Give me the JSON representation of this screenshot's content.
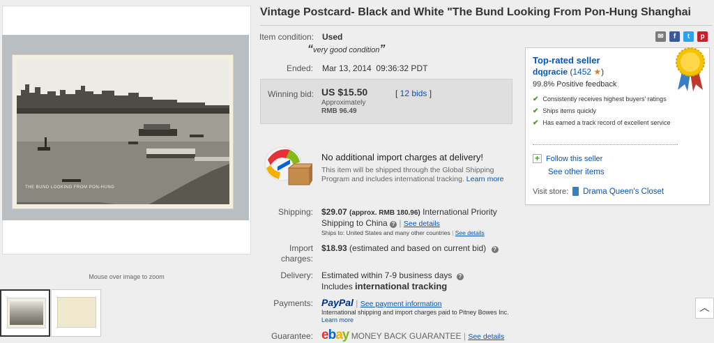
{
  "listing": {
    "title": "Vintage Postcard- Black and White \"The Bund Looking From Pon-Hung Shanghai",
    "condition_label": "Item condition:",
    "condition_value": "Used",
    "condition_note": "very good condition",
    "ended_label": "Ended:",
    "ended_value": "Mar 13, 2014",
    "ended_time": "09:36:32 PDT",
    "bid_label": "Winning bid:",
    "bid_value": "US $15.50",
    "bids_link": "12 bids",
    "approx_label": "Approximately",
    "approx_value": "RMB 96.49"
  },
  "image": {
    "zoom_hint": "Mouse over image to zoom",
    "postcard_caption": "THE BUND LOOKING FROM PON-HUNG"
  },
  "import_promo": {
    "heading": "No additional import charges at delivery!",
    "body": "This item will be shipped through the Global Shipping Program and includes international tracking.",
    "learn_more": "Learn more"
  },
  "shipping": {
    "label": "Shipping:",
    "price": "$29.07",
    "approx": "(approx. RMB 180.96)",
    "service": "International Priority Shipping to China",
    "see_details": "See details",
    "ships_to": "Ships to:  United States and many other countries",
    "ships_to_details": "See details"
  },
  "import_charges": {
    "label_line1": "Import",
    "label_line2": "charges:",
    "amount": "$18.93",
    "note": "(estimated and based on current bid)"
  },
  "delivery": {
    "label": "Delivery:",
    "estimate": "Estimated within 7-9 business days",
    "includes": "Includes",
    "tracking": "international tracking"
  },
  "payments": {
    "label": "Payments:",
    "paypal": "PayPal",
    "see_payment": "See payment information",
    "note": "International shipping and import charges paid to Pitney Bowes Inc.",
    "learn_more": "Learn more"
  },
  "guarantee": {
    "label": "Guarantee:",
    "brand": "ebay",
    "text": "MONEY BACK GUARANTEE",
    "see_details": "See details"
  },
  "seller": {
    "badge_title": "Top-rated seller",
    "username": "dqgracie",
    "score": "1452",
    "feedback": "99.8% Positive feedback",
    "features": [
      "Consistently receives highest buyers' ratings",
      "Ships items quickly",
      "Has earned a track record of excellent service"
    ],
    "follow": "Follow this seller",
    "see_other": "See other items",
    "visit_store_label": "Visit store:",
    "store_name": "Drama Queen's Closet"
  },
  "share_icons": [
    "email-icon",
    "facebook-icon",
    "twitter-icon",
    "pinterest-icon"
  ],
  "colors": {
    "link": "#0654ba",
    "ebay_e": "#e53238",
    "ebay_b": "#0064d2",
    "ebay_a": "#f5af02",
    "ebay_y": "#86b817",
    "badge_gold": "#e8b800",
    "check_green": "#4a9b2b"
  }
}
